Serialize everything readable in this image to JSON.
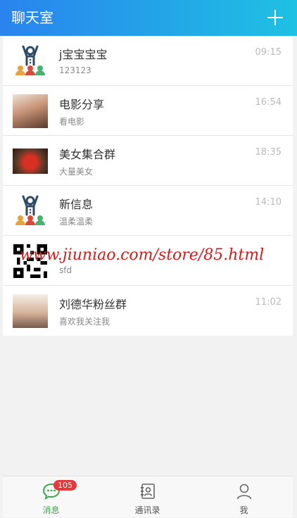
{
  "header": {
    "title": "聊天室",
    "add_icon": "plus-icon"
  },
  "chats": [
    {
      "name": "j宝宝宝宝",
      "message": "123123",
      "time": "09:15",
      "avatar": "group-people-icon"
    },
    {
      "name": "电影分享",
      "message": "看电影",
      "time": "16:54",
      "avatar": "photo"
    },
    {
      "name": "美女集合群",
      "message": "大量美女",
      "time": "18:35",
      "avatar": "photo"
    },
    {
      "name": "新信息",
      "message": "温柔温柔",
      "time": "14:10",
      "avatar": "group-people-icon"
    },
    {
      "name": "",
      "message": "sfd",
      "time": "",
      "avatar": "qr-code"
    },
    {
      "name": "刘德华粉丝群",
      "message": "喜欢我关注我",
      "time": "11:02",
      "avatar": "photo"
    }
  ],
  "watermark": "www.jiuniao.com/store/85.html",
  "tabs": [
    {
      "label": "消息",
      "icon": "chat-bubble-icon",
      "badge": "105",
      "active": true
    },
    {
      "label": "通讯录",
      "icon": "contacts-icon"
    },
    {
      "label": "我",
      "icon": "user-icon"
    }
  ],
  "colors": {
    "header_start": "#2a83ee",
    "header_end": "#1ec1e3",
    "active_tab": "#3aa84a",
    "badge": "#e23a3a"
  }
}
